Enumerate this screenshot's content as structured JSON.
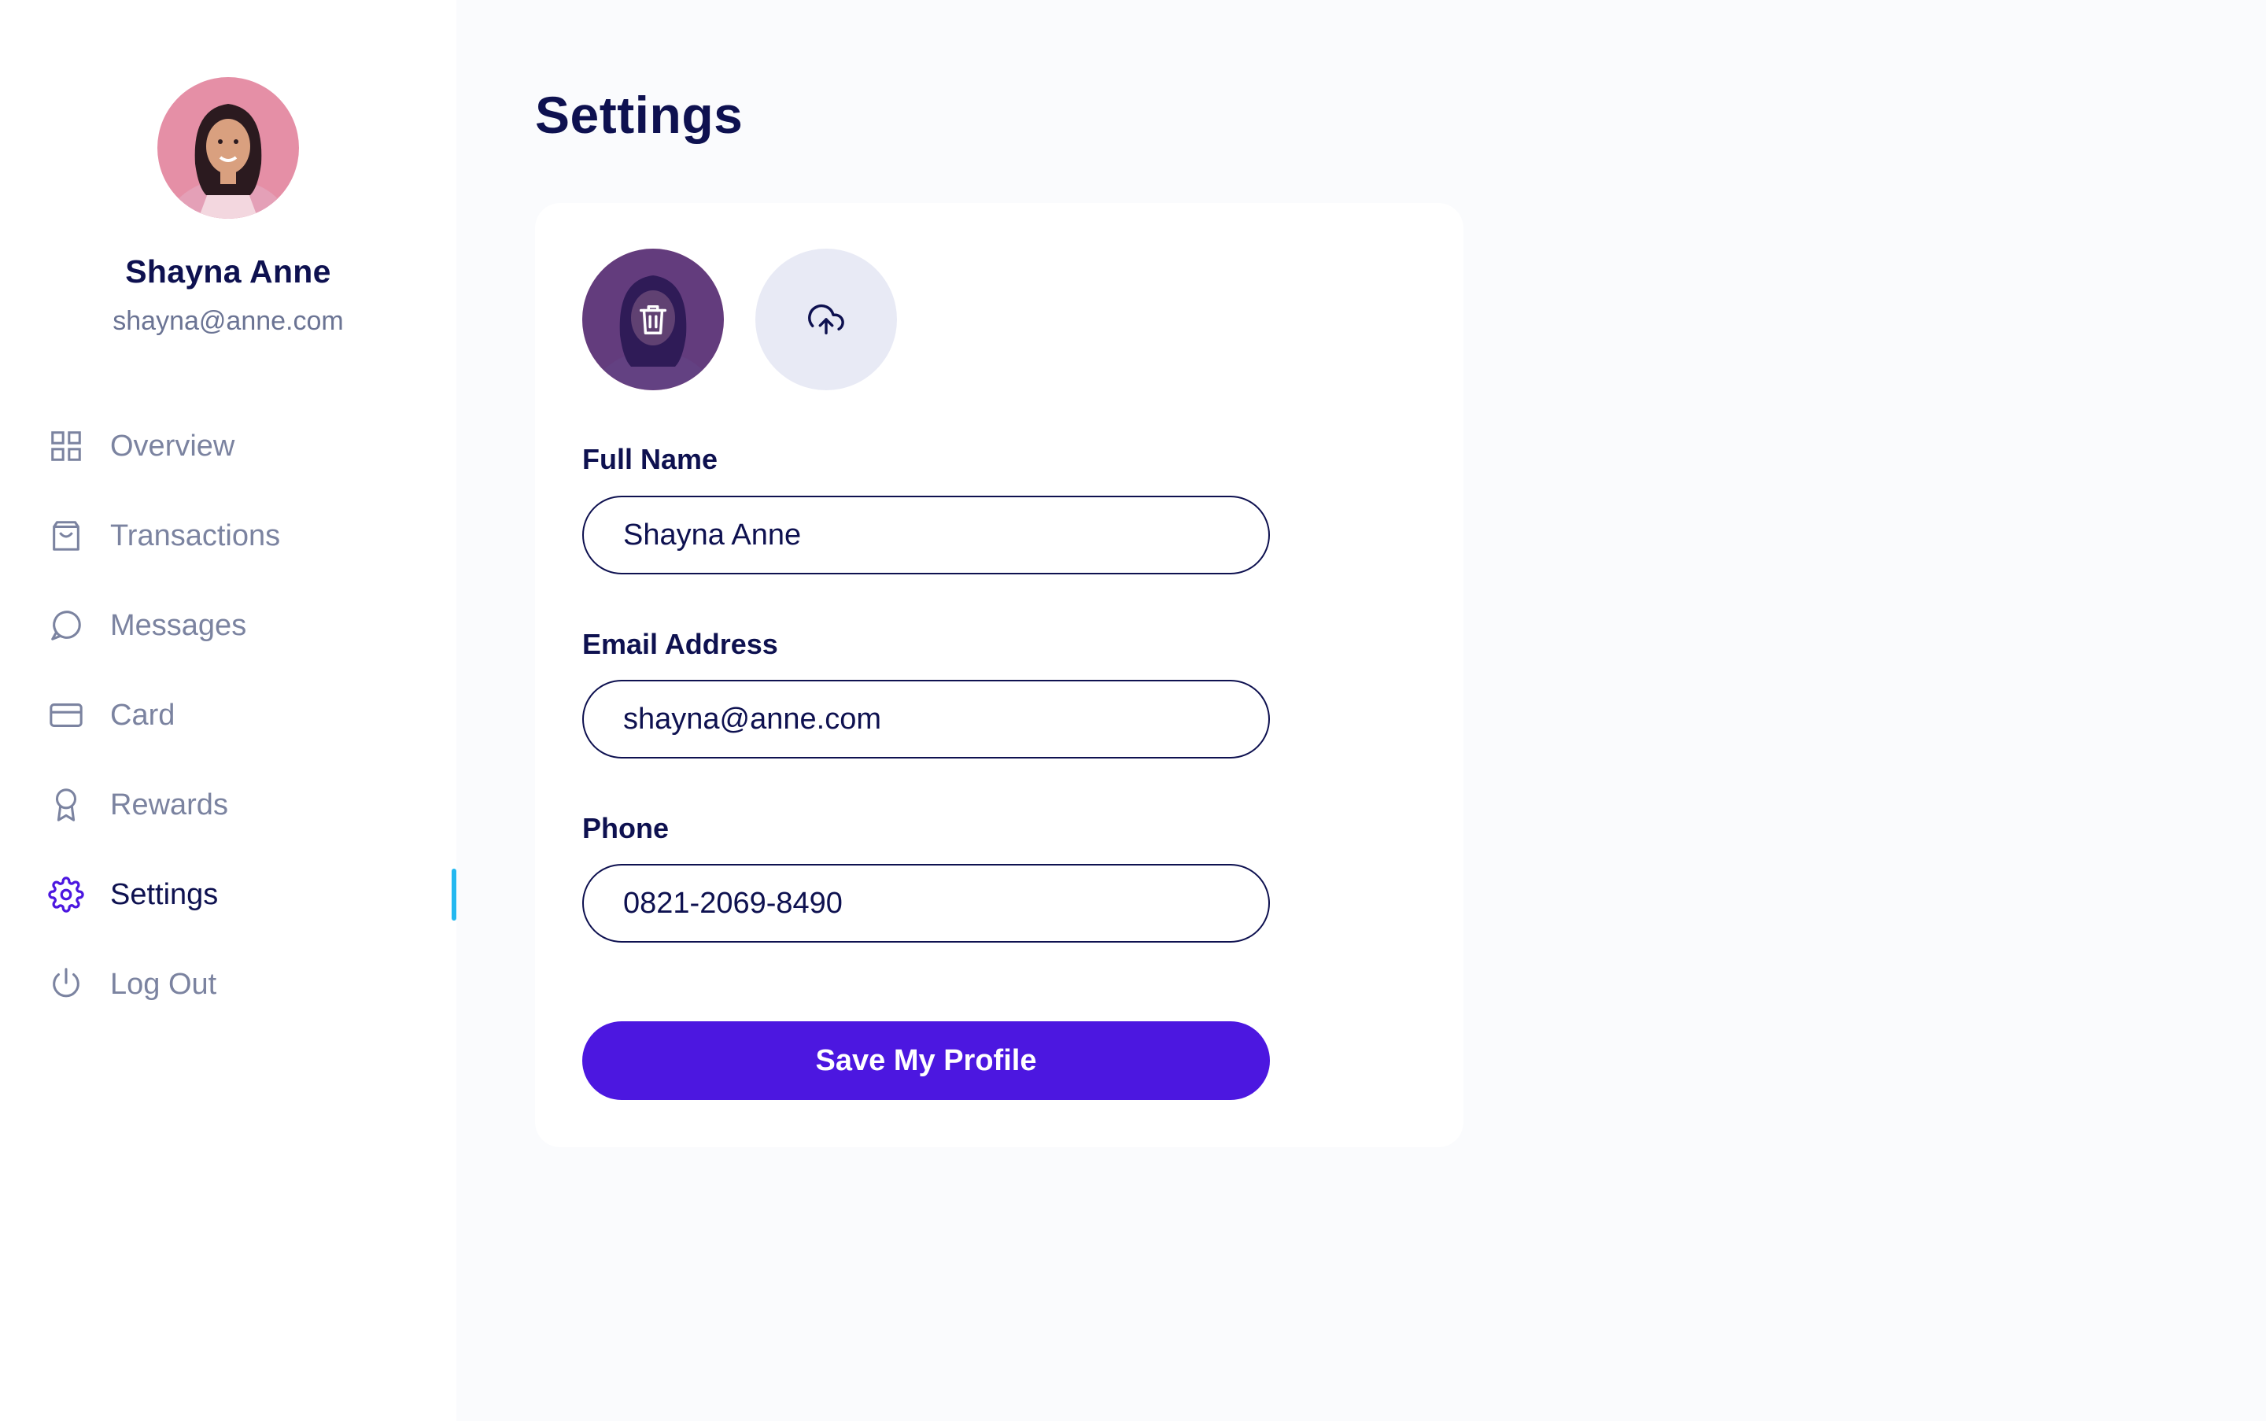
{
  "user": {
    "name": "Shayna Anne",
    "email": "shayna@anne.com"
  },
  "sidebar": {
    "items": [
      {
        "label": "Overview",
        "icon": "grid-icon",
        "active": false
      },
      {
        "label": "Transactions",
        "icon": "shopping-bag-icon",
        "active": false
      },
      {
        "label": "Messages",
        "icon": "message-bubble-icon",
        "active": false
      },
      {
        "label": "Card",
        "icon": "credit-card-icon",
        "active": false
      },
      {
        "label": "Rewards",
        "icon": "award-ribbon-icon",
        "active": false
      },
      {
        "label": "Settings",
        "icon": "gear-icon",
        "active": true
      },
      {
        "label": "Log Out",
        "icon": "power-icon",
        "active": false
      }
    ]
  },
  "page": {
    "title": "Settings"
  },
  "form": {
    "photo": {
      "delete_icon": "trash-icon",
      "upload_icon": "cloud-upload-icon"
    },
    "full_name": {
      "label": "Full Name",
      "value": "Shayna Anne"
    },
    "email": {
      "label": "Email Address",
      "value": "shayna@anne.com"
    },
    "phone": {
      "label": "Phone",
      "value": "0821-2069-8490"
    },
    "save_label": "Save My Profile"
  },
  "colors": {
    "primary": "#4c17e0",
    "text_dark": "#0e1150",
    "text_muted": "#7b83a0",
    "active_indicator": "#23b8f0",
    "icon_active": "#4c17e0",
    "page_bg": "#fafbfd",
    "upload_bg": "#e8eaf5"
  }
}
